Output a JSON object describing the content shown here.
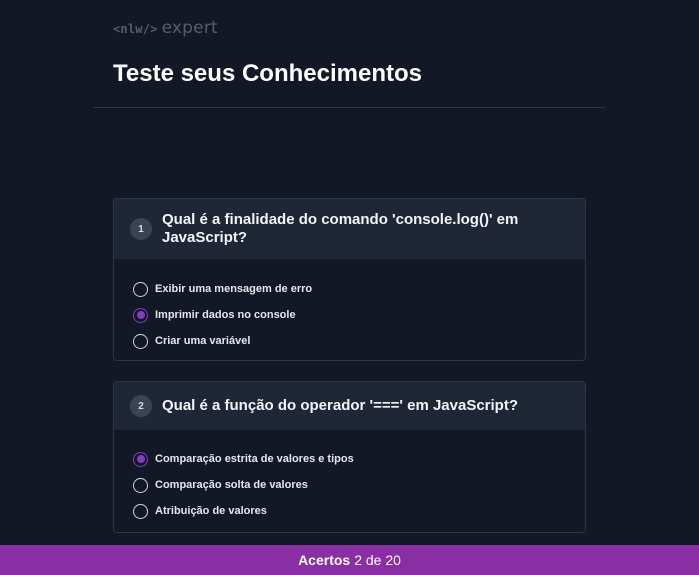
{
  "logo": {
    "tag": "<nlw/>",
    "word": "expert"
  },
  "page_title": "Teste seus Conhecimentos",
  "questions": [
    {
      "number": "1",
      "text": "Qual é a finalidade do comando 'console.log()' em JavaScript?",
      "options": [
        {
          "label": "Exibir uma mensagem de erro",
          "checked": false
        },
        {
          "label": "Imprimir dados no console",
          "checked": true
        },
        {
          "label": "Criar uma variável",
          "checked": false
        }
      ]
    },
    {
      "number": "2",
      "text": "Qual é a função do operador '===' em JavaScript?",
      "options": [
        {
          "label": "Comparação estrita de valores e tipos",
          "checked": true
        },
        {
          "label": "Comparação solta de valores",
          "checked": false
        },
        {
          "label": "Atribuição de valores",
          "checked": false
        }
      ]
    }
  ],
  "footer": {
    "label": "Acertos",
    "score": "2 de 20"
  },
  "colors": {
    "background": "#121826",
    "accent": "#8a2ea6",
    "card_header": "#1f2737"
  }
}
